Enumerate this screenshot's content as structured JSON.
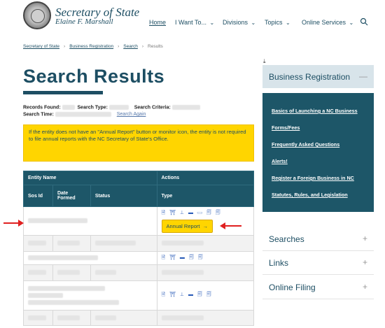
{
  "header": {
    "org_name": "Secretary of State",
    "org_sub": "Elaine F. Marshall",
    "nav": [
      {
        "label": "Home"
      },
      {
        "label": "I Want To..."
      },
      {
        "label": "Divisions"
      },
      {
        "label": "Topics"
      },
      {
        "label": "Online Services"
      }
    ]
  },
  "breadcrumb": [
    "Secretary of State",
    "Business Registration",
    "Search",
    "Results"
  ],
  "page_title": "Search Results",
  "meta": {
    "records_found_label": "Records Found:",
    "search_type_label": "Search Type:",
    "search_criteria_label": "Search Criteria:",
    "search_time_label": "Search Time:",
    "search_again": "Search Again"
  },
  "notice": "If the entity does not have an \"Annual Report\" button or monitor icon, the entity is not required to file annual reports with the NC Secretary of State's Office.",
  "table": {
    "header_entity_name": "Entity Name",
    "header_actions": "Actions",
    "header_sos_id": "Sos Id",
    "header_date_formed": "Date Formed",
    "header_status": "Status",
    "header_type": "Type",
    "annual_report_button": "Annual Report",
    "action_icons_full": "🗎 ⛩ ⊥ ▬ ▭ 🗐 🗐",
    "action_icons_short": "🗎 ⛩ ▬ 🗐 🗐",
    "action_icons_mid": "🗎 ⛩ ⊥ ▬ 🗐 🗐"
  },
  "sidebar": {
    "panel_title": "Business Registration",
    "links": [
      "Basics of Launching a NC Business",
      "Forms/Fees",
      "Frequently Asked Questions",
      "Alerts!",
      "Register a Foreign Business in NC",
      "Statutes, Rules, and Legislation"
    ],
    "accordions": [
      "Searches",
      "Links",
      "Online Filing"
    ]
  },
  "colors": {
    "primary": "#1d5668",
    "notice": "#ffd500",
    "arrow": "#e02020"
  }
}
